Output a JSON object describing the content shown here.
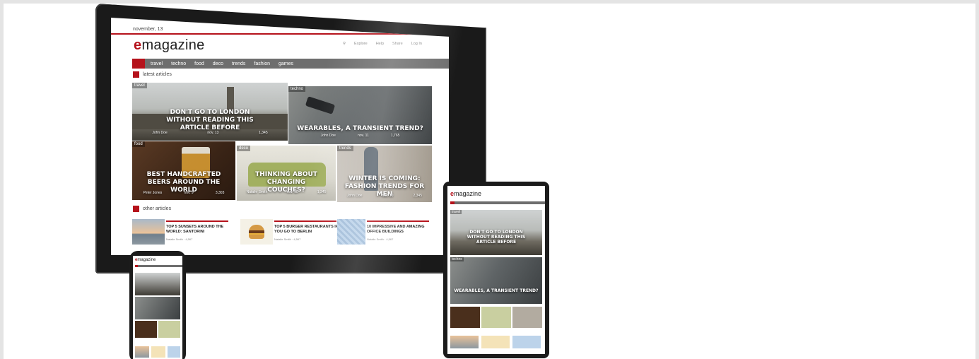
{
  "site": {
    "date": "november, 13",
    "logo_e": "e",
    "logo_rest": "magazine",
    "top_links": [
      "Explore",
      "Help",
      "Share"
    ],
    "login": "Log In",
    "nav": [
      "travel",
      "techno",
      "food",
      "deco",
      "trends",
      "fashion",
      "games"
    ],
    "latest_heading": "latest articles",
    "other_heading": "other articles"
  },
  "featured": [
    {
      "tag": "travel",
      "title": "Don't go to London without reading this article before",
      "author": "John Doe",
      "date": "nov. 13",
      "views": "1,345"
    },
    {
      "tag": "techno",
      "title": "Wearables, a transient trend?",
      "author": "John Doe",
      "date": "nov. 11",
      "views": "1,765"
    },
    {
      "tag": "food",
      "title": "Best handcrafted beers around the world",
      "author": "Peter Jones",
      "date": "nov. 9",
      "views": "3,303"
    },
    {
      "tag": "deco",
      "title": "Thinking about changing couches?",
      "author": "Natalie Smith",
      "date": "nov. 10",
      "views": "1,345"
    },
    {
      "tag": "trends",
      "title": "Winter is coming: fashion trends for men",
      "author": "John Doe",
      "date": "nov. 10",
      "views": "2,345"
    }
  ],
  "others": [
    {
      "title": "Top 5 sunsets around the world: Santorini",
      "meta": "Natalie Smith · 4,567"
    },
    {
      "title": "Top 5 burger restaurants if you go to Berlin",
      "meta": "Natalie Smith · 4,567"
    },
    {
      "title": "10 impressive and amazing office buildings",
      "meta": "Natalie Smith · 4,567"
    }
  ],
  "colors": {
    "brand": "#b5121b",
    "nav": "#6e6e6e"
  }
}
